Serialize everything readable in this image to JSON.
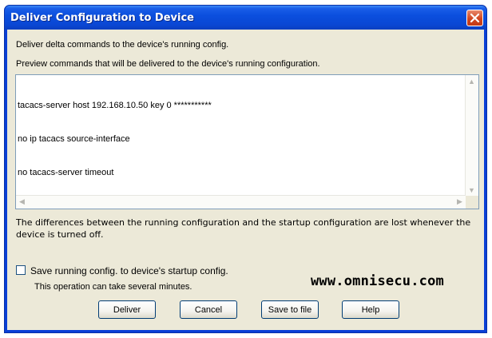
{
  "window": {
    "title": "Deliver Configuration to Device"
  },
  "intro": {
    "line1": "Deliver delta commands to the device's running config.",
    "line2": "Preview commands that will be delivered to the device's running configuration."
  },
  "preview": {
    "lines": [
      "tacacs-server host 192.168.10.50 key 0 ***********",
      "no ip tacacs source-interface",
      "no tacacs-server timeout"
    ]
  },
  "note": {
    "text": "The differences between the running configuration and the startup configuration are lost whenever the device is turned off."
  },
  "save_option": {
    "label": "Save running config. to device's startup config.",
    "checked": false,
    "hint": "This operation can take several minutes."
  },
  "watermark": "www.omnisecu.com",
  "buttons": {
    "deliver": "Deliver",
    "cancel": "Cancel",
    "save_to_file": "Save to file",
    "help": "Help"
  }
}
